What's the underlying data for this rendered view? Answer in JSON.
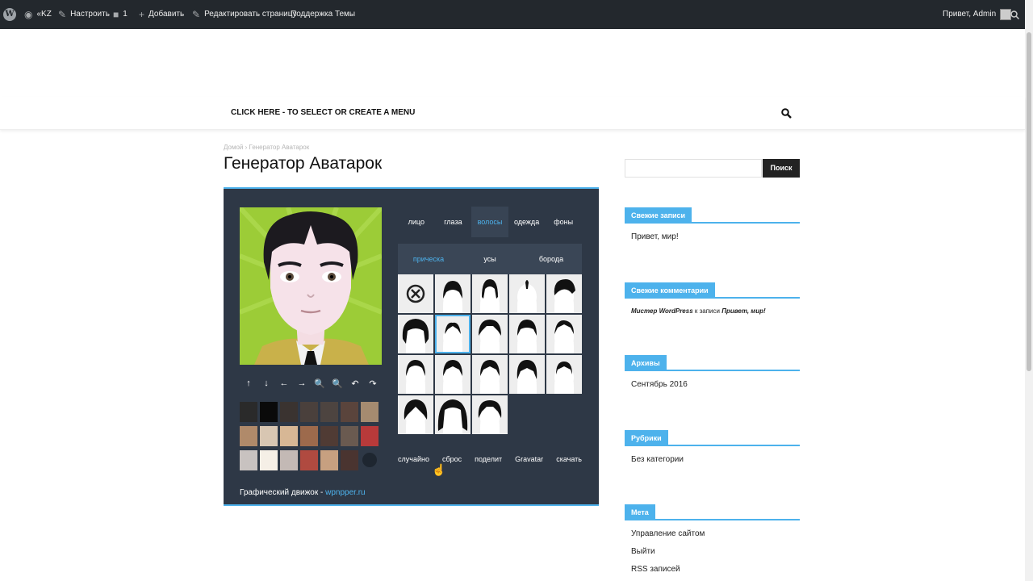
{
  "adminbar": {
    "site": "«KZ",
    "customize": "Настроить",
    "comments_count": "1",
    "add_new": "Добавить",
    "edit_page": "Редактировать страницу",
    "theme_support": "Поддержка Темы",
    "greeting": "Привет, Admin"
  },
  "nav": {
    "menu_text": "CLICK HERE - TO SELECT OR CREATE A MENU"
  },
  "breadcrumb": {
    "home": "Домой",
    "separator": "›",
    "current": "Генератор Аватарок"
  },
  "page": {
    "title": "Генератор Аватарок"
  },
  "avatar": {
    "tabs": [
      {
        "label": "лицо"
      },
      {
        "label": "глаза"
      },
      {
        "label": "волосы"
      },
      {
        "label": "одежда"
      },
      {
        "label": "фоны"
      }
    ],
    "active_tab": "волосы",
    "subtabs": [
      {
        "label": "прическа"
      },
      {
        "label": "усы"
      },
      {
        "label": "борода"
      }
    ],
    "active_subtab": "прическа",
    "controls": [
      "↑",
      "↓",
      "←",
      "→",
      "🔍",
      "🔍",
      "↶",
      "↷"
    ],
    "swatch_colors": [
      "#2a2a2a",
      "#0a0a0a",
      "#3a3330",
      "#4a403c",
      "#4d4440",
      "#5a443c",
      "#a58b70",
      "#b08a6a",
      "#d8c6b2",
      "#d7b795",
      "#9d6a4c",
      "#503b34",
      "#6a5a50",
      "#b83a3a",
      "#c8c2c0",
      "#f5efe6",
      "#c3b9b5",
      "#b04a40",
      "#c7a080",
      "#4a3430",
      "#1e2630"
    ],
    "actions": [
      {
        "label": "случайно"
      },
      {
        "label": "сброс"
      },
      {
        "label": "поделит"
      },
      {
        "label": "Gravatar"
      },
      {
        "label": "скачать"
      }
    ],
    "engine_label": "Графический движок - ",
    "engine_link": "wpnpper.ru"
  },
  "sidebar": {
    "search_button": "Поиск",
    "widgets": [
      {
        "title": "Свежие записи",
        "items": [
          "Привет, мир!"
        ]
      },
      {
        "title": "Свежие комментарии",
        "comment_author": "Мистер WordPress",
        "comment_mid": " к записи ",
        "comment_post": "Привет, мир!"
      },
      {
        "title": "Архивы",
        "items": [
          "Сентябрь 2016"
        ]
      },
      {
        "title": "Рубрики",
        "items": [
          "Без категории"
        ]
      },
      {
        "title": "Мета",
        "items": [
          "Управление сайтом",
          "Выйти",
          "RSS записей"
        ]
      }
    ]
  }
}
